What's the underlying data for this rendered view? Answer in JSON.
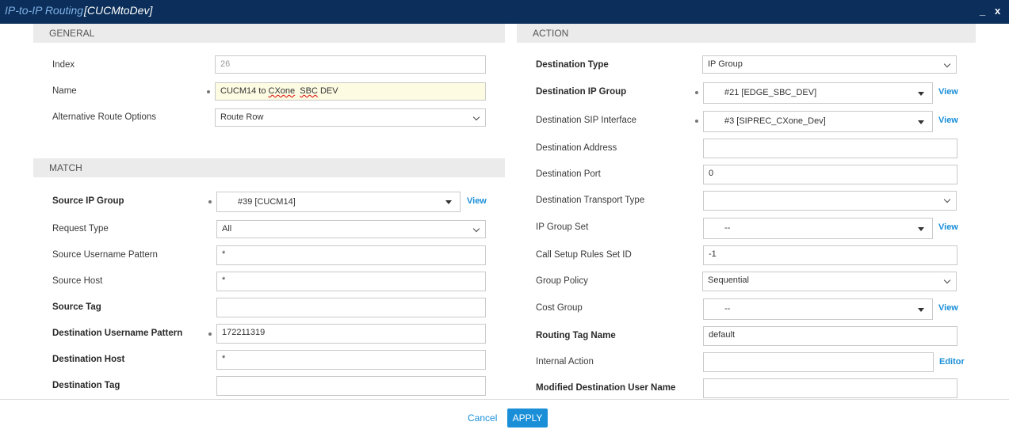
{
  "window": {
    "title_prefix": "IP-to-IP Routing",
    "title_name": "[CUCMtoDev]",
    "minimize": "_",
    "close": "x"
  },
  "general": {
    "header": "GENERAL",
    "index_label": "Index",
    "index_value": "26",
    "name_label": "Name",
    "name_value_pre": "CUCM14 to ",
    "name_value_w1": "CXone",
    "name_value_mid": "  ",
    "name_value_w2": "SBC",
    "name_value_post": " DEV",
    "alt_route_label": "Alternative Route Options",
    "alt_route_value": "Route Row"
  },
  "match": {
    "header": "MATCH",
    "source_ip_group_label": "Source IP Group",
    "source_ip_group_value": "#39 [CUCM14]",
    "source_ip_group_link": "View",
    "request_type_label": "Request Type",
    "request_type_value": "All",
    "source_username_label": "Source Username Pattern",
    "source_username_value": "*",
    "source_host_label": "Source Host",
    "source_host_value": "*",
    "source_tag_label": "Source Tag",
    "source_tag_value": "",
    "dest_username_label": "Destination Username Pattern",
    "dest_username_value": "172211319",
    "dest_host_label": "Destination Host",
    "dest_host_value": "*",
    "dest_tag_label": "Destination Tag",
    "dest_tag_value": ""
  },
  "action": {
    "header": "ACTION",
    "dest_type_label": "Destination Type",
    "dest_type_value": "IP Group",
    "dest_ip_group_label": "Destination IP Group",
    "dest_ip_group_value": "#21 [EDGE_SBC_DEV]",
    "dest_ip_group_link": "View",
    "dest_sip_iface_label": "Destination SIP Interface",
    "dest_sip_iface_value": "#3 [SIPREC_CXone_Dev]",
    "dest_sip_iface_link": "View",
    "dest_address_label": "Destination Address",
    "dest_address_value": "",
    "dest_port_label": "Destination Port",
    "dest_port_value": "0",
    "dest_transport_label": "Destination Transport Type",
    "dest_transport_value": "",
    "ip_group_set_label": "IP Group Set",
    "ip_group_set_value": "--",
    "ip_group_set_link": "View",
    "call_setup_label": "Call Setup Rules Set ID",
    "call_setup_value": "-1",
    "group_policy_label": "Group Policy",
    "group_policy_value": "Sequential",
    "cost_group_label": "Cost Group",
    "cost_group_value": "--",
    "cost_group_link": "View",
    "routing_tag_label": "Routing Tag Name",
    "routing_tag_value": "default",
    "internal_action_label": "Internal Action",
    "internal_action_value": "",
    "internal_action_link": "Editor",
    "modified_dest_user_label": "Modified Destination User Name",
    "modified_dest_user_value": ""
  },
  "footer": {
    "cancel": "Cancel",
    "apply": "APPLY"
  }
}
